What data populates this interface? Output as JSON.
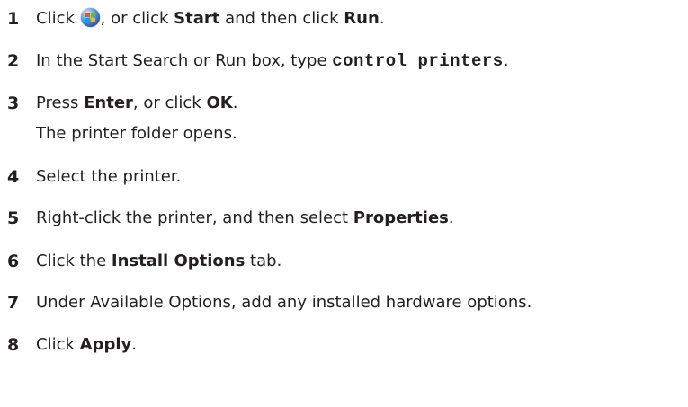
{
  "steps": [
    {
      "number": "1",
      "parts": {
        "a": "Click ",
        "b": ", or click ",
        "c": "Start",
        "d": " and then click ",
        "e": "Run",
        "f": "."
      },
      "icon": "windows-start-orb-icon"
    },
    {
      "number": "2",
      "parts": {
        "a": "In the Start Search or Run box, type ",
        "code": "control printers",
        "f": "."
      }
    },
    {
      "number": "3",
      "parts": {
        "a": "Press ",
        "b": "Enter",
        "c": ", or click ",
        "d": "OK",
        "e": "."
      },
      "result": "The printer folder opens."
    },
    {
      "number": "4",
      "text": "Select the printer."
    },
    {
      "number": "5",
      "parts": {
        "a": "Right-click the printer, and then select ",
        "b": "Properties",
        "c": "."
      }
    },
    {
      "number": "6",
      "parts": {
        "a": "Click the ",
        "b": "Install Options",
        "c": " tab."
      }
    },
    {
      "number": "7",
      "text": "Under Available Options, add any installed hardware options."
    },
    {
      "number": "8",
      "parts": {
        "a": "Click ",
        "b": "Apply",
        "c": "."
      }
    }
  ]
}
